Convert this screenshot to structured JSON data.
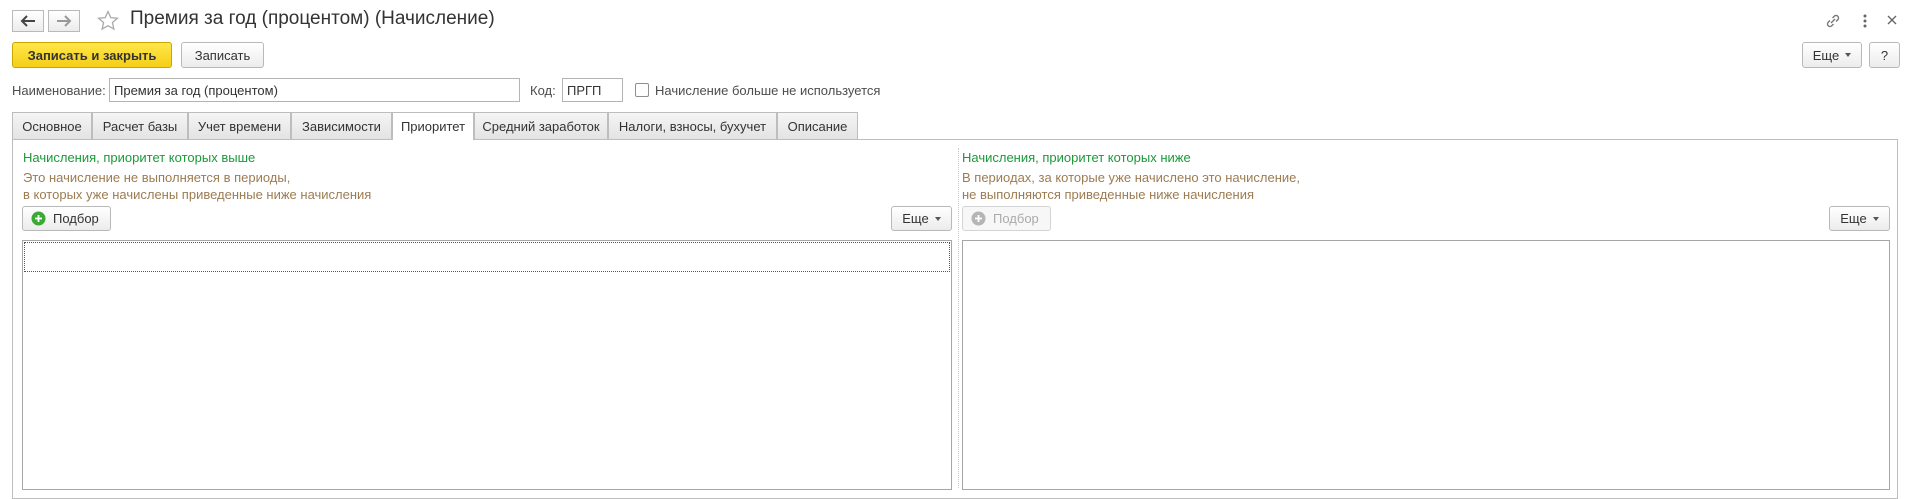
{
  "header": {
    "back_icon": "arrow-left-icon",
    "forward_icon": "arrow-right-icon",
    "favorite_icon": "star-icon",
    "title": "Премия за год (процентом) (Начисление)",
    "link_icon": "link-icon",
    "menu_icon": "more-vertical-icon",
    "close_icon": "close-icon"
  },
  "toolbar": {
    "save_close_label": "Записать и закрыть",
    "save_label": "Записать",
    "more_label": "Еще",
    "help_label": "?"
  },
  "form": {
    "name_label": "Наименование:",
    "name_value": "Премия за год (процентом)",
    "code_label": "Код:",
    "code_value": "ПРГП",
    "not_used_label": "Начисление больше не используется",
    "not_used_checked": false
  },
  "tabs": [
    {
      "label": "Основное",
      "active": false
    },
    {
      "label": "Расчет базы",
      "active": false
    },
    {
      "label": "Учет времени",
      "active": false
    },
    {
      "label": "Зависимости",
      "active": false
    },
    {
      "label": "Приоритет",
      "active": true
    },
    {
      "label": "Средний заработок",
      "active": false
    },
    {
      "label": "Налоги, взносы, бухучет",
      "active": false
    },
    {
      "label": "Описание",
      "active": false
    }
  ],
  "left_panel": {
    "title": "Начисления, приоритет которых выше",
    "desc_line1": "Это начисление не выполняется в периоды,",
    "desc_line2": "в которых уже начислены приведенные ниже начисления",
    "pick_label": "Подбор",
    "pick_icon": "add-circle-icon",
    "more_label": "Еще"
  },
  "right_panel": {
    "title": "Начисления, приоритет которых ниже",
    "desc_line1": "В периодах, за которые уже начислено это начисление,",
    "desc_line2": "не выполняются приведенные ниже начисления",
    "pick_label": "Подбор",
    "pick_icon": "add-circle-icon",
    "more_label": "Еще"
  },
  "colors": {
    "primary_button": "#f5cf17",
    "section_title": "#1a9a3a",
    "description": "#9c7c52",
    "pick_icon_enabled": "#3aaa35",
    "pick_icon_disabled": "#b5b5b5"
  }
}
